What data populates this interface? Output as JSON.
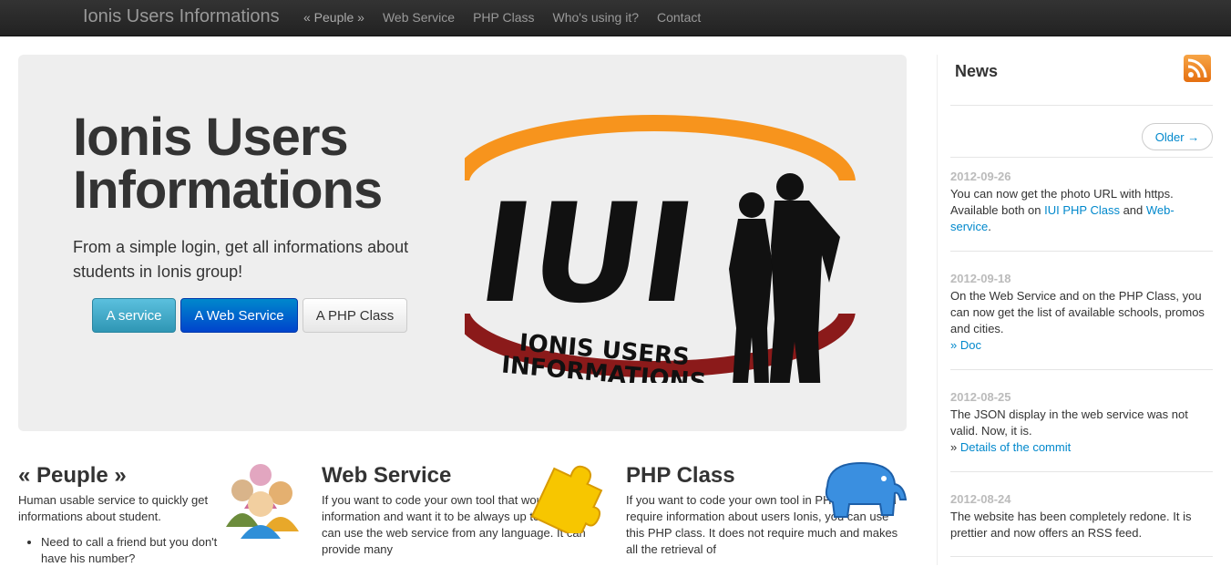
{
  "navbar": {
    "brand": "Ionis Users Informations",
    "items": [
      "« Peuple »",
      "Web Service",
      "PHP Class",
      "Who's using it?",
      "Contact"
    ]
  },
  "hero": {
    "title": "Ionis Users Informations",
    "subtitle": "From a simple login, get all informations about students in Ionis group!",
    "buttons": [
      "A service",
      "A Web Service",
      "A PHP Class"
    ],
    "logo": {
      "big": "IUI",
      "line1": "IONIS USERS",
      "line2": "INFORMATIONS"
    }
  },
  "features": [
    {
      "title": "« Peuple »",
      "text": "Human usable service to quickly get informations about student.",
      "bullet": "Need to call a friend but you don't have his number?"
    },
    {
      "title": "Web Service",
      "text": "If you want to code your own tool that would need information and want it to be always up to date, you can use the web service from any language. It can provide many"
    },
    {
      "title": "PHP Class",
      "text": "If you want to code your own tool in PHP that would require information about users Ionis, you can use this PHP class. It does not require much and makes all the retrieval of"
    }
  ],
  "news": {
    "title": "News",
    "older_label": "Older →",
    "items": [
      {
        "date": "2012-09-26",
        "text1": "You can now get the photo URL with https. Available both on ",
        "link1": "IUI PHP Class",
        "text2": " and ",
        "link2": "Web-service",
        "text3": "."
      },
      {
        "date": "2012-09-18",
        "text1": "On the Web Service and on the PHP Class, you can now get the list of available schools, promos and cities.",
        "link1": "» Doc"
      },
      {
        "date": "2012-08-25",
        "text1": "The JSON display in the web service was not valid. Now, it is.",
        "prefix": "» ",
        "link1": "Details of the commit"
      },
      {
        "date": "2012-08-24",
        "text1": "The website has been completely redone. It is prettier and now offers an RSS feed."
      }
    ]
  },
  "colors": {
    "navbar": "#222222",
    "hero_bg": "#eeeeee",
    "link": "#0088cc",
    "logo_orange": "#f7941d",
    "logo_red": "#8b1a1a"
  }
}
